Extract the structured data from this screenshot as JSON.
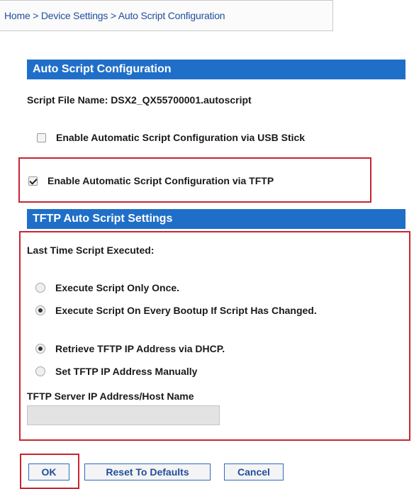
{
  "breadcrumb": "Home > Device Settings > Auto Script Configuration",
  "auto_script": {
    "header": "Auto Script Configuration",
    "script_file_name": "Script File Name: DSX2_QX55700001.autoscript",
    "usb_label": "Enable Automatic Script Configuration via USB Stick",
    "usb_checked": false,
    "tftp_label": "Enable Automatic Script Configuration via TFTP",
    "tftp_checked": true
  },
  "tftp_settings": {
    "header": "TFTP Auto Script Settings",
    "last_time_label": "Last Time Script Executed:",
    "execute_options": [
      {
        "label": "Execute Script Only Once.",
        "selected": false
      },
      {
        "label": "Execute Script On Every Bootup If Script Has Changed.",
        "selected": true
      }
    ],
    "address_options": [
      {
        "label": "Retrieve TFTP IP Address via DHCP.",
        "selected": true
      },
      {
        "label": "Set TFTP IP Address Manually",
        "selected": false
      }
    ],
    "server_label": "TFTP Server IP Address/Host Name",
    "server_value": ""
  },
  "buttons": {
    "ok": "OK",
    "reset": "Reset To Defaults",
    "cancel": "Cancel"
  },
  "colors": {
    "header_bg": "#1f6fc9",
    "highlight": "#c8252f",
    "link": "#1f4e9c"
  }
}
